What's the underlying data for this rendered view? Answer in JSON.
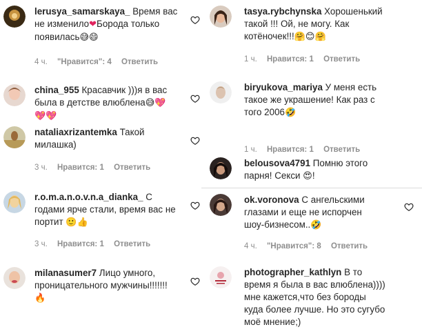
{
  "icons": {
    "like": "heart-outline-icon"
  },
  "colors": {
    "meta": "#8e8e8e",
    "text": "#262626",
    "separator": "#dbdbdb"
  },
  "left": [
    {
      "user": "lerusya_samarskaya_",
      "lines": [
        "Время вас",
        "не изменило",
        "Борода только",
        "появилась"
      ],
      "time": "4 ч.",
      "likes": "\"Нравится\": 4",
      "reply": "Ответить"
    },
    {
      "user": "china_955",
      "lines": [
        "Красавчик )))я в вас",
        "была в детстве влюблена"
      ],
      "time": "",
      "likes": "",
      "reply": ""
    },
    {
      "user": "nataliaxrizantemka",
      "lines": [
        "Такой",
        "милашка)"
      ],
      "time": "3 ч.",
      "likes": "Нравится: 1",
      "reply": "Ответить"
    },
    {
      "user": "r.o.m.a.n.o.v.n.a_dianka_",
      "lines": [
        "С",
        "годами ярче стали, время вас не",
        "портит"
      ],
      "time": "3 ч.",
      "likes": "Нравится: 1",
      "reply": "Ответить"
    },
    {
      "user": "milanasumer7",
      "lines": [
        "Лицо умного,",
        "проницательного мужчины!!!!!!!"
      ],
      "time": "",
      "likes": "",
      "reply": ""
    }
  ],
  "right": [
    {
      "user": "tasya.rybchynska",
      "lines": [
        "Хорошенький",
        "такой !!! Ой, не могу. Как",
        "котёночек!!!"
      ],
      "time": "1 ч.",
      "likes": "Нравится: 1",
      "reply": "Ответить"
    },
    {
      "user": "biryukova_mariya",
      "lines": [
        "У меня есть",
        "такое же украшение! Как раз с",
        "того 2006"
      ],
      "time": "1 ч.",
      "likes": "Нравится: 1",
      "reply": "Ответить"
    },
    {
      "user": "belousova4791",
      "lines": [
        "Помню этого",
        "парня! Секси",
        "!"
      ],
      "time": "",
      "likes": "",
      "reply": ""
    },
    {
      "user": "ok.voronova",
      "lines": [
        "С ангельскими",
        "глазами и еще не испорчен",
        "шоу-бизнесом.."
      ],
      "time": "4 ч.",
      "likes": "\"Нравится\": 8",
      "reply": "Ответить"
    },
    {
      "user": "photographer_kathlyn",
      "lines": [
        "В то",
        "время я была в вас влюблена))))",
        "мне кажется,что без бороды",
        "куда более лучше. Но это сугубо",
        "моё мнение;)"
      ],
      "time": "",
      "likes": "",
      "reply": ""
    }
  ]
}
